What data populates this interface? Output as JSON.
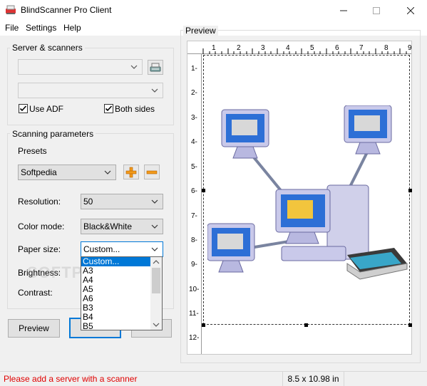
{
  "window": {
    "title": "BlindScanner Pro Client",
    "minimize": "—",
    "maximize": "☐",
    "close": "✕"
  },
  "menu": [
    "File",
    "Settings",
    "Help"
  ],
  "server_group": {
    "label": "Server & scanners",
    "server_value": "",
    "scanner_value": "",
    "use_adf_label": "Use ADF",
    "use_adf_checked": true,
    "both_sides_label": "Both sides",
    "both_sides_checked": true
  },
  "scan_group": {
    "label": "Scanning parameters",
    "presets_label": "Presets",
    "preset_value": "Softpedia",
    "resolution_label": "Resolution:",
    "resolution_value": "50",
    "color_mode_label": "Color mode:",
    "color_mode_value": "Black&White",
    "paper_size_label": "Paper size:",
    "paper_size_value": "Custom...",
    "brightness_label": "Brightness:",
    "contrast_label": "Contrast:"
  },
  "paper_options": [
    "Custom...",
    "A3",
    "A4",
    "A5",
    "A6",
    "B3",
    "B4",
    "B5"
  ],
  "buttons": {
    "preview": "Preview"
  },
  "preview": {
    "label": "Preview",
    "ruler_top": [
      "1",
      "2",
      "3",
      "4",
      "5",
      "6",
      "7",
      "8",
      "9"
    ],
    "ruler_left": [
      "1-",
      "2-",
      "3-",
      "4-",
      "5-",
      "6-",
      "7-",
      "8-",
      "9-",
      "10-",
      "11-",
      "12-"
    ]
  },
  "status": {
    "message": "Please add a server with a scanner",
    "dimensions": "8.5 x 10.98 in"
  },
  "watermark": "SOFTPEDIA",
  "colors": {
    "accent": "#0078d7",
    "error": "#e00000"
  }
}
